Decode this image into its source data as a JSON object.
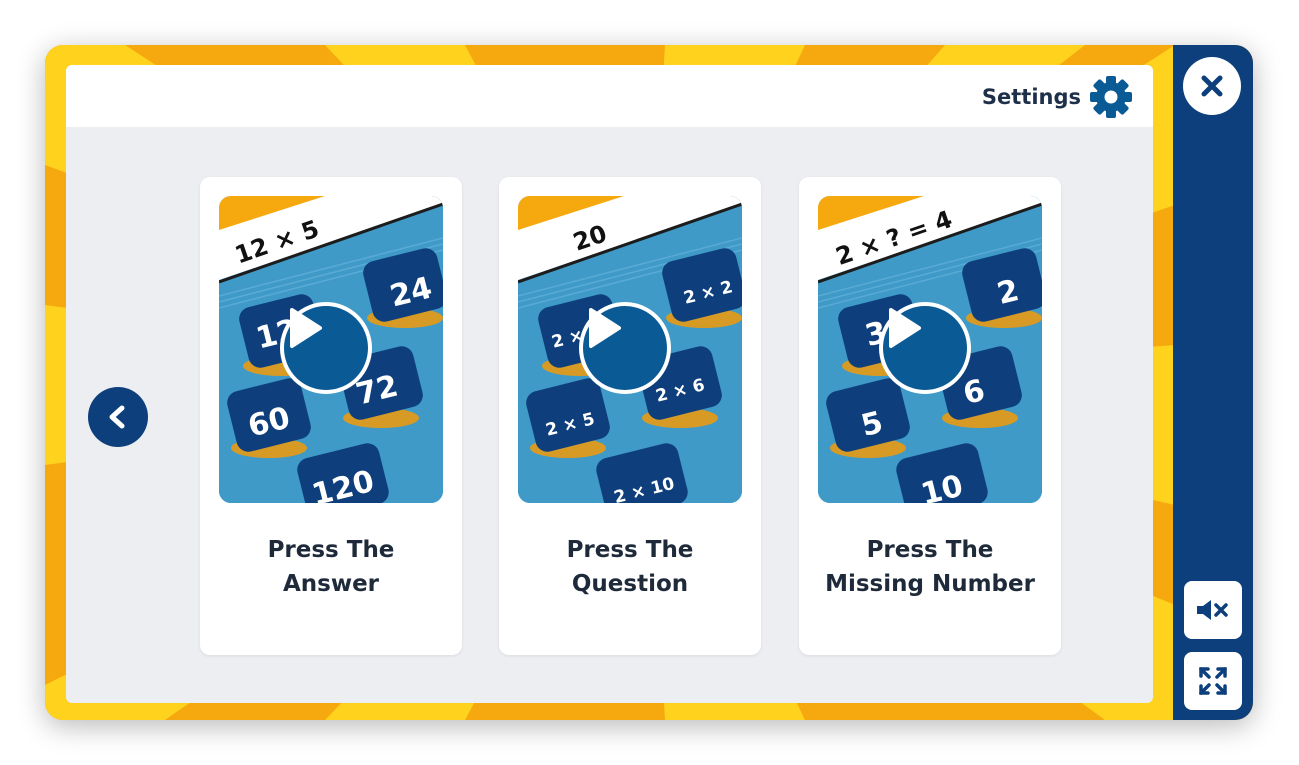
{
  "toolbar": {
    "settings_label": "Settings",
    "settings_icon": "gear-icon"
  },
  "sidebar": {
    "close_icon": "close-icon",
    "mute_icon": "speaker-muted-icon",
    "fullscreen_icon": "expand-icon"
  },
  "navigation": {
    "back_icon": "chevron-left-icon"
  },
  "cards": [
    {
      "title_line1": "Press The",
      "title_line2": "Answer",
      "banner": "12 × 5",
      "tiles": [
        "24",
        "12",
        "60",
        "72",
        "120"
      ]
    },
    {
      "title_line1": "Press The",
      "title_line2": "Question",
      "banner": "20",
      "tiles": [
        "2 × 2",
        "2 × 4",
        "2 × 5",
        "2 × 6",
        "2 × 10"
      ]
    },
    {
      "title_line1": "Press The",
      "title_line2": "Missing Number",
      "banner": "2 × ? = 4",
      "tiles": [
        "2",
        "3",
        "5",
        "6",
        "10"
      ]
    }
  ],
  "colors": {
    "brand_navy": "#0c3f7c",
    "frame_orange": "#f6a80f",
    "frame_yellow": "#ffd21e",
    "tile_blue": "#0e3f7c",
    "game_bg_blue": "#3f9ac8"
  }
}
